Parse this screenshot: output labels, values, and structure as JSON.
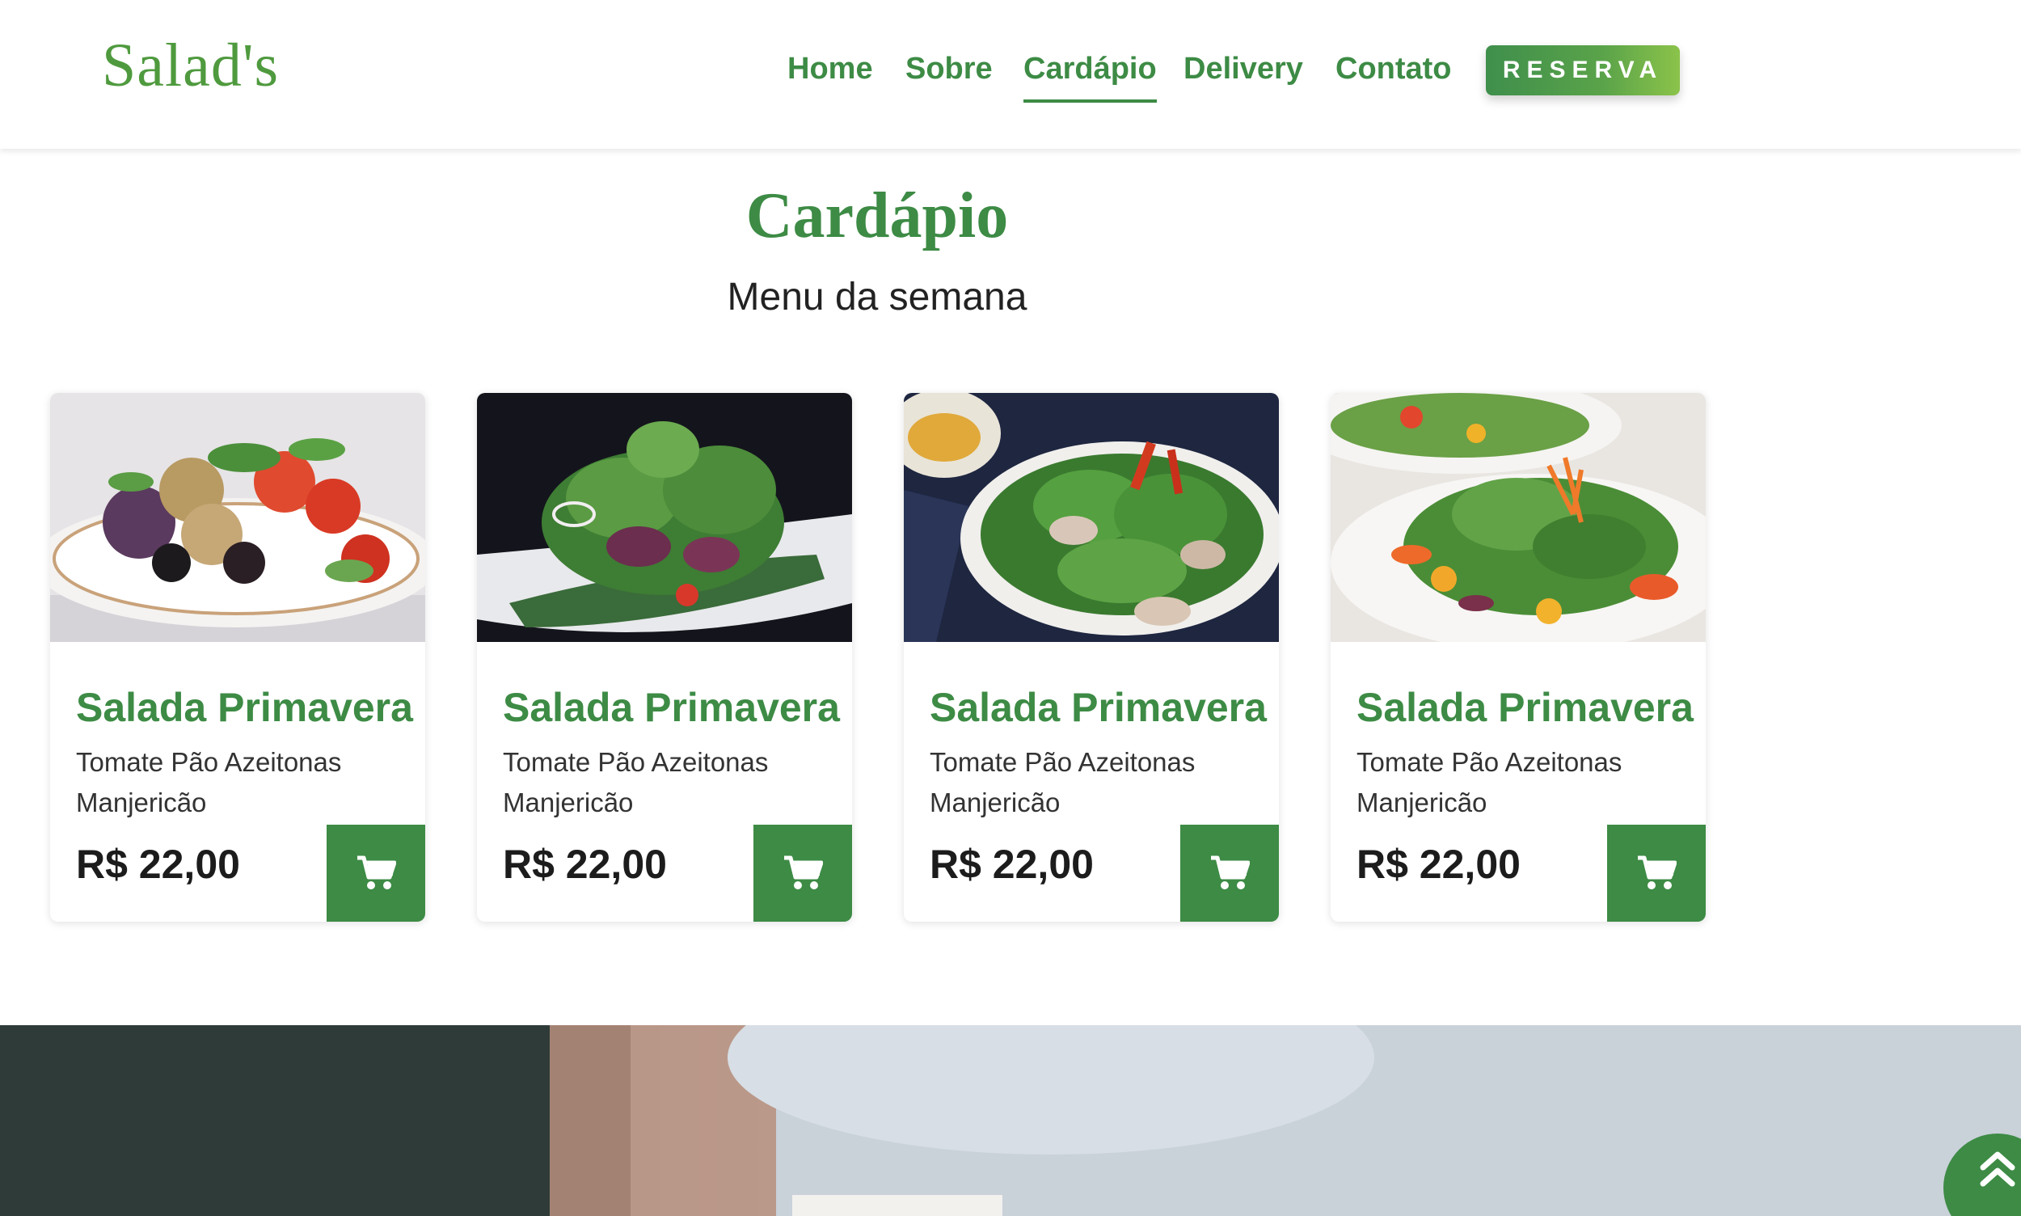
{
  "header": {
    "logo": "Salad's",
    "nav": [
      {
        "label": "Home",
        "active": false
      },
      {
        "label": "Sobre",
        "active": false
      },
      {
        "label": "Cardápio",
        "active": true
      },
      {
        "label": "Delivery",
        "active": false
      },
      {
        "label": "Contato",
        "active": false
      }
    ],
    "reserve_label": "RESERVA"
  },
  "section": {
    "title": "Cardápio",
    "subtitle": "Menu da semana"
  },
  "cards": [
    {
      "title": "Salada Primavera",
      "description": "Tomate Pão Azeitonas Manjericão",
      "price": "R$ 22,00",
      "icon": "cart-icon"
    },
    {
      "title": "Salada Primavera",
      "description": "Tomate Pão Azeitonas Manjericão",
      "price": "R$ 22,00",
      "icon": "cart-icon"
    },
    {
      "title": "Salada Primavera",
      "description": "Tomate Pão Azeitonas Manjericão",
      "price": "R$ 22,00",
      "icon": "cart-icon"
    },
    {
      "title": "Salada Primavera",
      "description": "Tomate Pão Azeitonas Manjericão",
      "price": "R$ 22,00",
      "icon": "cart-icon"
    }
  ],
  "scroll_top_icon": "double-chevron-up-icon",
  "colors": {
    "brand_green": "#3d8b45",
    "logo_green": "#4f9a3e",
    "button_gradient_end": "#8bc34a"
  }
}
